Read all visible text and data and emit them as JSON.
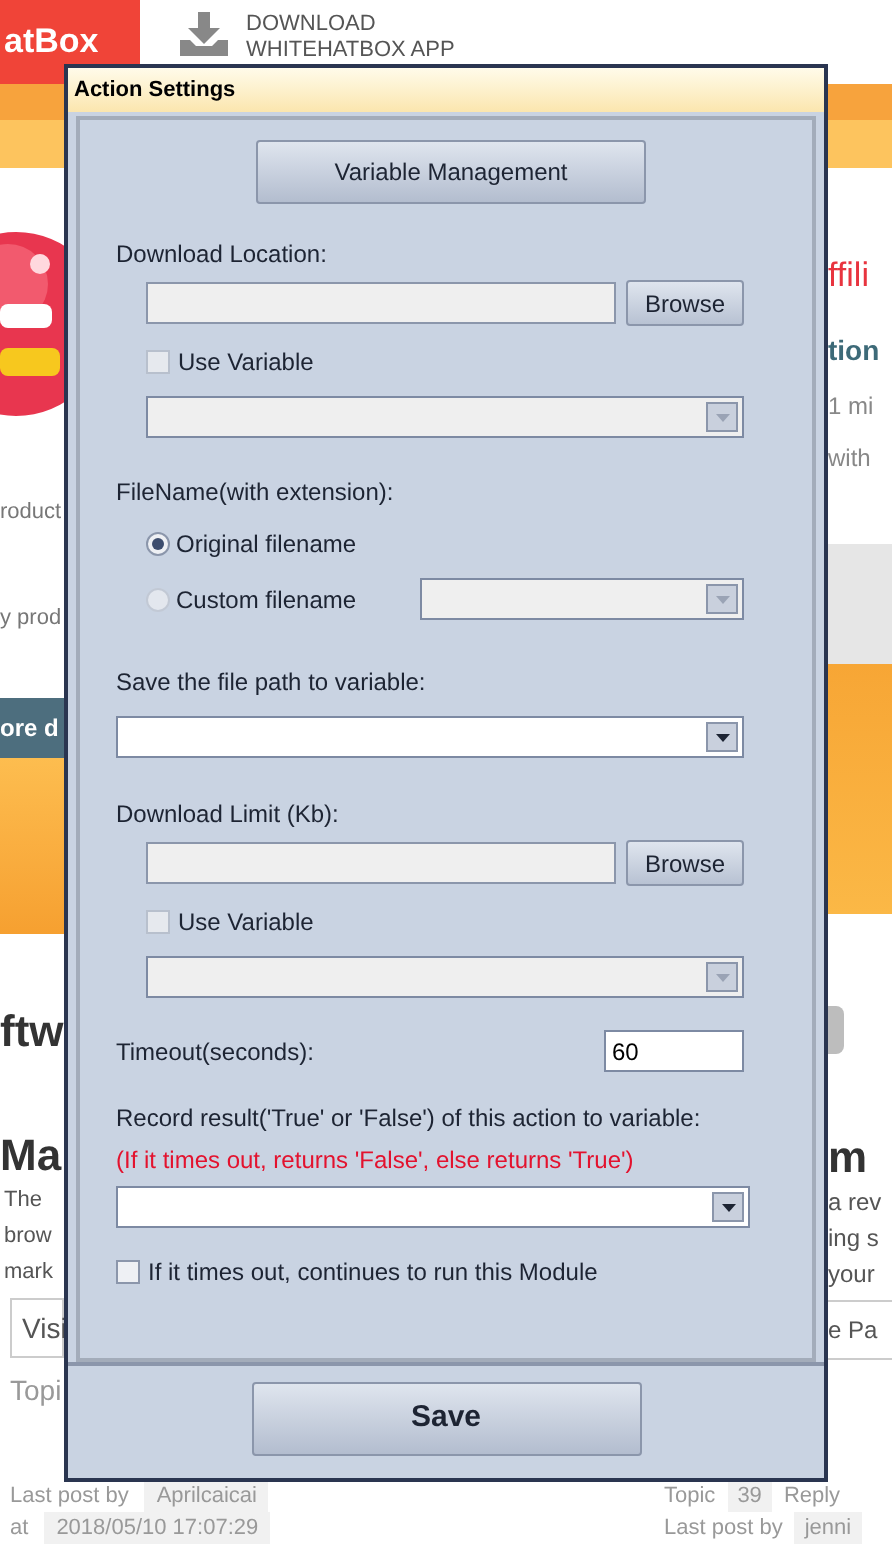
{
  "header": {
    "brand": "atBox",
    "download": "DOWNLOAD WHITEHATBOX APP"
  },
  "left": {
    "product_text": "roduct",
    "product_text_2": "y prod",
    "more_button": "ore d",
    "section_heading": "ftw",
    "card_title": "Ma",
    "card_lines": [
      "The",
      "brow",
      "mark"
    ],
    "card_field": "Visi",
    "topic_label": "Topi"
  },
  "right": {
    "title": "ffili",
    "subtitle": "tion",
    "meta_lines": [
      "1 mi",
      "with"
    ],
    "card_title": "m",
    "card_lines": [
      "a rev",
      "ing s",
      "your"
    ],
    "card_field": "e Pa"
  },
  "bottom": {
    "left": {
      "last_post_label": "Last post by",
      "author": "Aprilcaicai",
      "at_label": "at",
      "date": "2018/05/10 17:07:29"
    },
    "right": {
      "topic_label": "Topic",
      "topic_count": "39",
      "reply_label": "Reply",
      "last_post_label": "Last post by",
      "author": "jenni"
    }
  },
  "dialog": {
    "title": "Action Settings",
    "variable_button": "Variable Management",
    "download_location": {
      "label": "Download Location:",
      "field": {
        "disabled": true
      },
      "browse": "Browse",
      "use_variable": {
        "label": "Use Variable",
        "checked": false,
        "disabled": true
      },
      "variable_select": {
        "disabled": true
      }
    },
    "filename": {
      "label": "FileName(with extension):",
      "options": [
        {
          "label": "Original filename",
          "selected": true
        },
        {
          "label": "Custom filename",
          "selected": false
        }
      ],
      "custom_select": {
        "disabled": true
      }
    },
    "save_path": {
      "label": "Save the file path to variable:",
      "select": {
        "disabled": false
      }
    },
    "download_limit": {
      "label": "Download Limit (Kb):",
      "field": {
        "disabled": true
      },
      "browse": "Browse",
      "use_variable": {
        "label": "Use Variable",
        "checked": false,
        "disabled": true
      },
      "variable_select": {
        "disabled": true
      }
    },
    "timeout": {
      "label": "Timeout(seconds):",
      "value": "60"
    },
    "record": {
      "label": "Record result('True' or 'False') of this action to variable:",
      "note": "(If it times out, returns 'False', else returns 'True')",
      "select": {
        "disabled": false
      }
    },
    "continue_checkbox": {
      "label": "If it times out, continues to run this Module",
      "checked": false,
      "disabled": false
    },
    "save_button": "Save"
  }
}
